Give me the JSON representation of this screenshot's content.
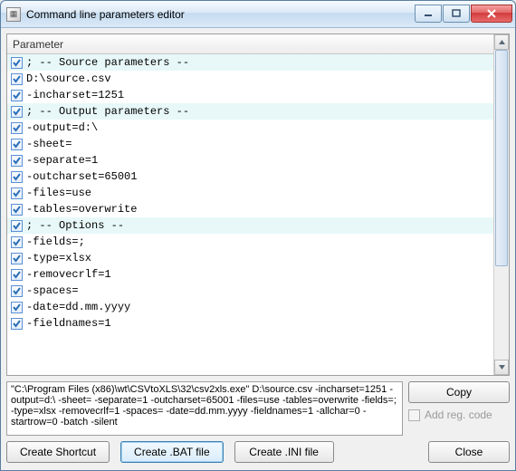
{
  "window": {
    "title": "Command line parameters editor"
  },
  "list": {
    "header": "Parameter",
    "rows": [
      {
        "checked": true,
        "text": "; -- Source parameters --",
        "highlight": true
      },
      {
        "checked": true,
        "text": "D:\\source.csv",
        "highlight": false
      },
      {
        "checked": true,
        "text": "-incharset=1251",
        "highlight": false
      },
      {
        "checked": true,
        "text": "; -- Output parameters --",
        "highlight": true
      },
      {
        "checked": true,
        "text": "-output=d:\\",
        "highlight": false
      },
      {
        "checked": true,
        "text": "-sheet=",
        "highlight": false
      },
      {
        "checked": true,
        "text": "-separate=1",
        "highlight": false
      },
      {
        "checked": true,
        "text": "-outcharset=65001",
        "highlight": false
      },
      {
        "checked": true,
        "text": "-files=use",
        "highlight": false
      },
      {
        "checked": true,
        "text": "-tables=overwrite",
        "highlight": false
      },
      {
        "checked": true,
        "text": "; -- Options --",
        "highlight": true
      },
      {
        "checked": true,
        "text": "-fields=;",
        "highlight": false
      },
      {
        "checked": true,
        "text": "-type=xlsx",
        "highlight": false
      },
      {
        "checked": true,
        "text": "-removecrlf=1",
        "highlight": false
      },
      {
        "checked": true,
        "text": "-spaces=",
        "highlight": false
      },
      {
        "checked": true,
        "text": "-date=dd.mm.yyyy",
        "highlight": false
      },
      {
        "checked": true,
        "text": "-fieldnames=1",
        "highlight": false
      }
    ]
  },
  "command_text": "\"C:\\Program Files (x86)\\wt\\CSVtoXLS\\32\\csv2xls.exe\" D:\\source.csv -incharset=1251 -output=d:\\ -sheet= -separate=1 -outcharset=65001 -files=use -tables=overwrite -fields=; -type=xlsx -removecrlf=1 -spaces= -date=dd.mm.yyyy -fieldnames=1 -allchar=0 -startrow=0 -batch -silent",
  "buttons": {
    "copy": "Copy",
    "add_reg": "Add reg. code",
    "create_shortcut": "Create Shortcut",
    "create_bat": "Create .BAT file",
    "create_ini": "Create .INI file",
    "close": "Close"
  }
}
